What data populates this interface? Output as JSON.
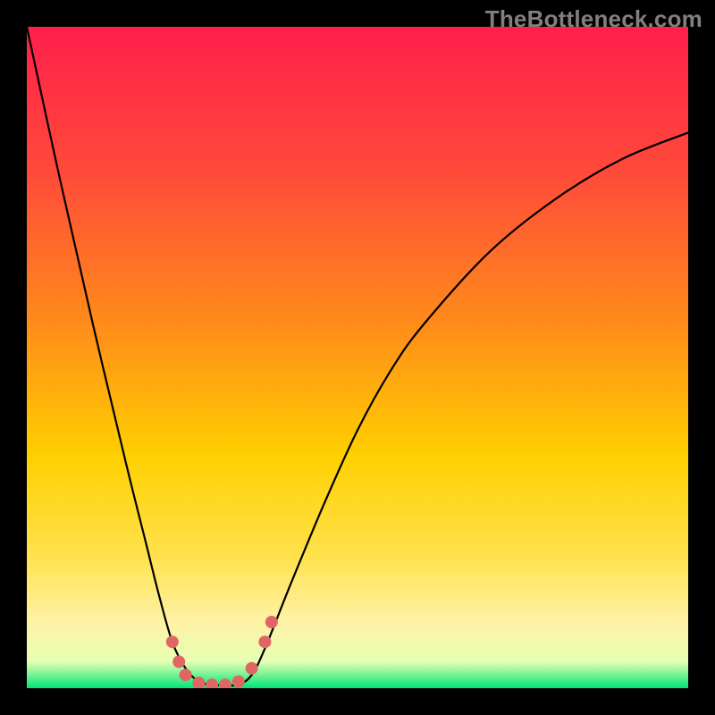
{
  "watermark": "TheBottleneck.com",
  "colors": {
    "frame": "#000000",
    "curve_stroke": "#000000",
    "marker_fill": "#e06666",
    "gradient_top": "#ff1f4b",
    "gradient_mid1": "#ff6a2a",
    "gradient_mid2": "#ffd000",
    "gradient_mid3": "#ffe066",
    "gradient_mid4": "#fff2a6",
    "gradient_baseline": "#00e676"
  },
  "chart_data": {
    "type": "line",
    "title": "",
    "xlabel": "",
    "ylabel": "",
    "xlim": [
      0,
      100
    ],
    "ylim": [
      0,
      100
    ],
    "background": "rainbow-vertical-gradient",
    "series": [
      {
        "name": "bottleneck-curve",
        "x": [
          0,
          5,
          10,
          15,
          18,
          20,
          22,
          24,
          26,
          28,
          30,
          32,
          34,
          36,
          40,
          45,
          50,
          55,
          60,
          70,
          80,
          90,
          100
        ],
        "y": [
          100,
          77,
          55,
          34,
          22,
          14,
          7,
          3,
          1,
          0.5,
          0.5,
          0.5,
          2,
          6,
          16,
          28,
          39,
          48,
          55,
          66,
          74,
          80,
          84
        ]
      }
    ],
    "markers": [
      {
        "x": 22,
        "y": 7
      },
      {
        "x": 23,
        "y": 4
      },
      {
        "x": 24,
        "y": 2
      },
      {
        "x": 26,
        "y": 0.8
      },
      {
        "x": 28,
        "y": 0.5
      },
      {
        "x": 30,
        "y": 0.5
      },
      {
        "x": 32,
        "y": 1
      },
      {
        "x": 34,
        "y": 3
      },
      {
        "x": 36,
        "y": 7
      },
      {
        "x": 37,
        "y": 10
      }
    ],
    "marker_radius_px": 7
  }
}
